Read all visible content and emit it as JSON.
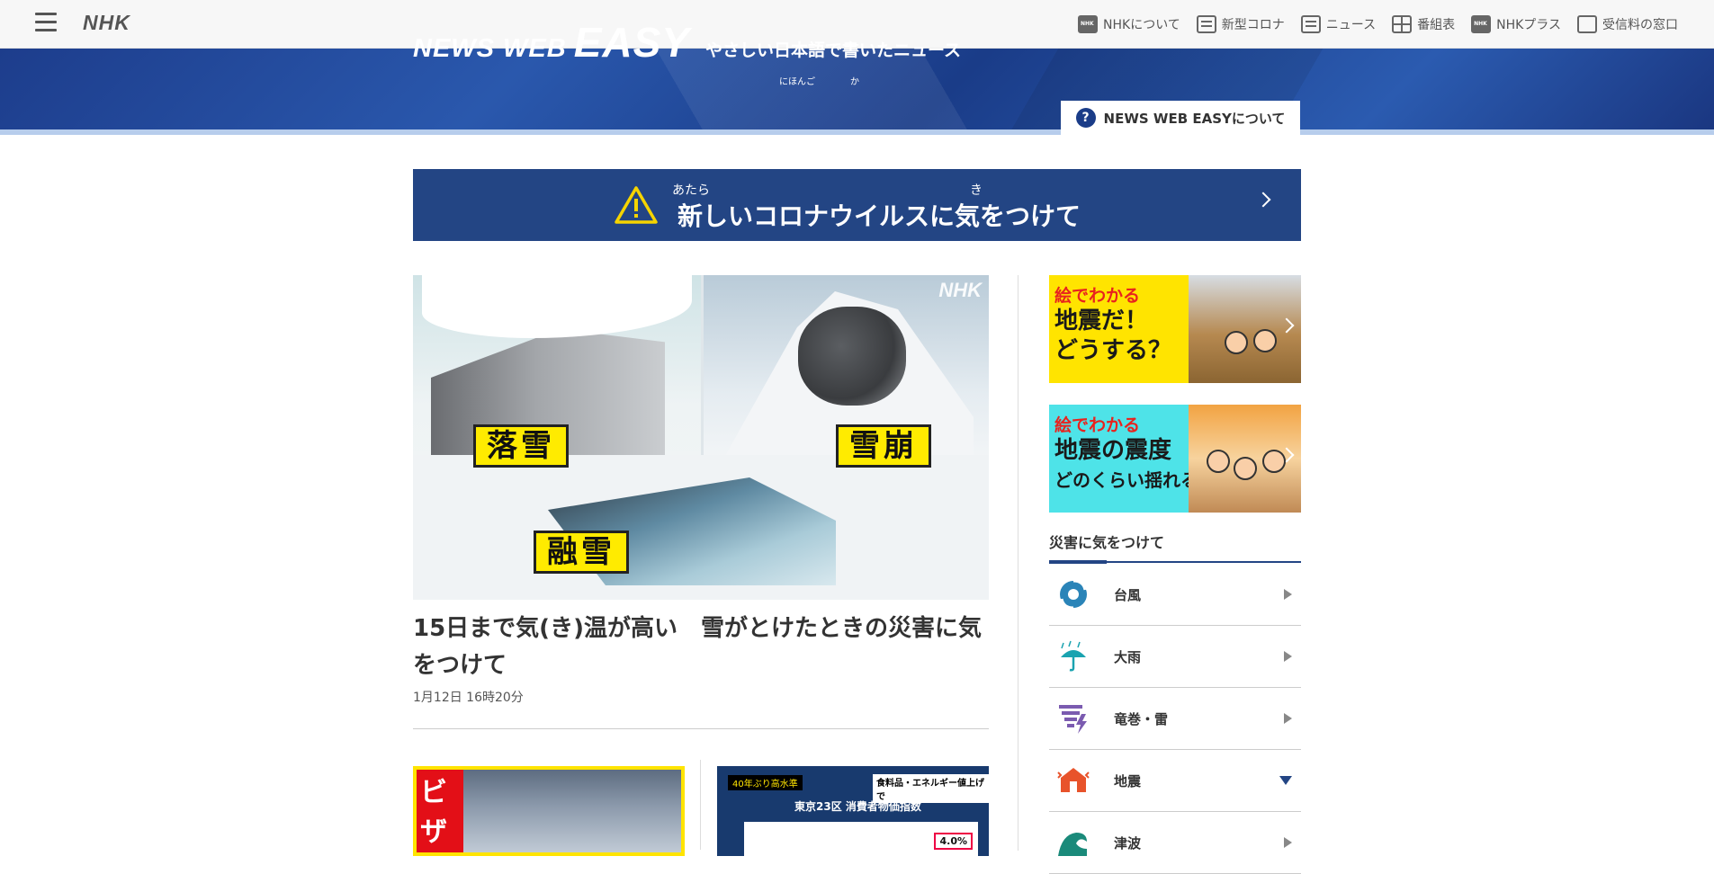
{
  "topbar": {
    "logo": "NHK",
    "nav": [
      {
        "label": "NHKについて",
        "icon": "nhk-icon"
      },
      {
        "label": "新型コロナ",
        "icon": "corona-icon"
      },
      {
        "label": "ニュース",
        "icon": "news-icon"
      },
      {
        "label": "番組表",
        "icon": "program-guide-icon"
      },
      {
        "label": "NHKプラス",
        "icon": "nhk-plus-icon"
      },
      {
        "label": "受信料の窓口",
        "icon": "fee-window-icon"
      }
    ]
  },
  "banner": {
    "logo_news_web": "NEWS WEB",
    "logo_easy": "EASY",
    "tagline": "やさしい日本語で書いたニュース",
    "ruby_nihongo": "にほんご",
    "ruby_ka": "か",
    "about_label": "NEWS WEB EASYについて"
  },
  "alert": {
    "text": "新しいコロナウイルスに気をつけて",
    "ruby_atara": "あたら",
    "ruby_ki": "き"
  },
  "main_article": {
    "image_labels": [
      "落雪",
      "雪崩",
      "融雪"
    ],
    "image_watermark": "NHK",
    "title": "15日まで気(き)温が高い　雪がとけたときの災害に気をつけて",
    "date": "1月12日 16時20分"
  },
  "thumbs": {
    "thumb1_text": "ビザ",
    "thumb2_top_left": "40年ぶり高水準",
    "thumb2_top_right": "食料品・エネルギー値上げで",
    "thumb2_title": "東京23区 消費者物価指数",
    "thumb2_value": "4.0%"
  },
  "sidebar": {
    "promo1": {
      "small": "絵でわかる",
      "big1": "地震だ！",
      "big2": "どうする？"
    },
    "promo2": {
      "small": "絵でわかる",
      "big1": "地震の震度",
      "big2": "どのくらい揺れる？"
    },
    "disaster_title": "災害に気をつけて",
    "disasters": [
      {
        "label": "台風",
        "icon": "typhoon-icon",
        "color": "#2a84b8"
      },
      {
        "label": "大雨",
        "icon": "heavy-rain-icon",
        "color": "#1aa3b0"
      },
      {
        "label": "竜巻・雷",
        "icon": "tornado-icon",
        "color": "#7b5bb0"
      },
      {
        "label": "地震",
        "icon": "earthquake-icon",
        "color": "#e8532b"
      },
      {
        "label": "津波",
        "icon": "tsunami-icon",
        "color": "#1a8a7a"
      }
    ]
  },
  "colors": {
    "accent": "#234584",
    "banner": "#1d3d8c",
    "label_yellow": "#ffeb00"
  }
}
